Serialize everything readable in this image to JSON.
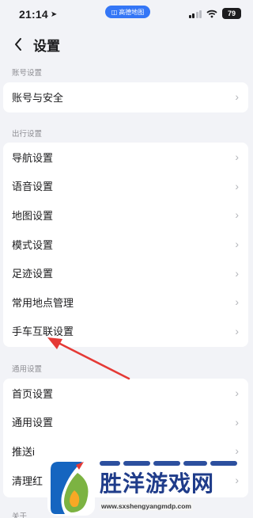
{
  "status_bar": {
    "time": "21:14",
    "app_pill": "高德地图",
    "battery": "79"
  },
  "nav": {
    "title": "设置"
  },
  "sections": [
    {
      "header": "账号设置",
      "items": [
        {
          "label": "账号与安全"
        }
      ]
    },
    {
      "header": "出行设置",
      "items": [
        {
          "label": "导航设置"
        },
        {
          "label": "语音设置"
        },
        {
          "label": "地图设置"
        },
        {
          "label": "模式设置"
        },
        {
          "label": "足迹设置"
        },
        {
          "label": "常用地点管理"
        },
        {
          "label": "手车互联设置"
        }
      ]
    },
    {
      "header": "通用设置",
      "items": [
        {
          "label": "首页设置"
        },
        {
          "label": "通用设置"
        },
        {
          "label": "推送i"
        },
        {
          "label": "清理红"
        }
      ]
    },
    {
      "header": "关于"
    }
  ],
  "watermark": {
    "title": "胜洋游戏网",
    "url": "www.sxshengyangmdp.com"
  },
  "colors": {
    "background": "#f2f3f7",
    "accent": "#3476f6",
    "annotation": "#e53935"
  },
  "icons": {
    "back": "chevron-left-icon",
    "row": "chevron-right-icon",
    "location": "location-arrow-icon",
    "signal": "cellular-signal-icon",
    "wifi": "wifi-icon",
    "battery": "battery-icon"
  }
}
